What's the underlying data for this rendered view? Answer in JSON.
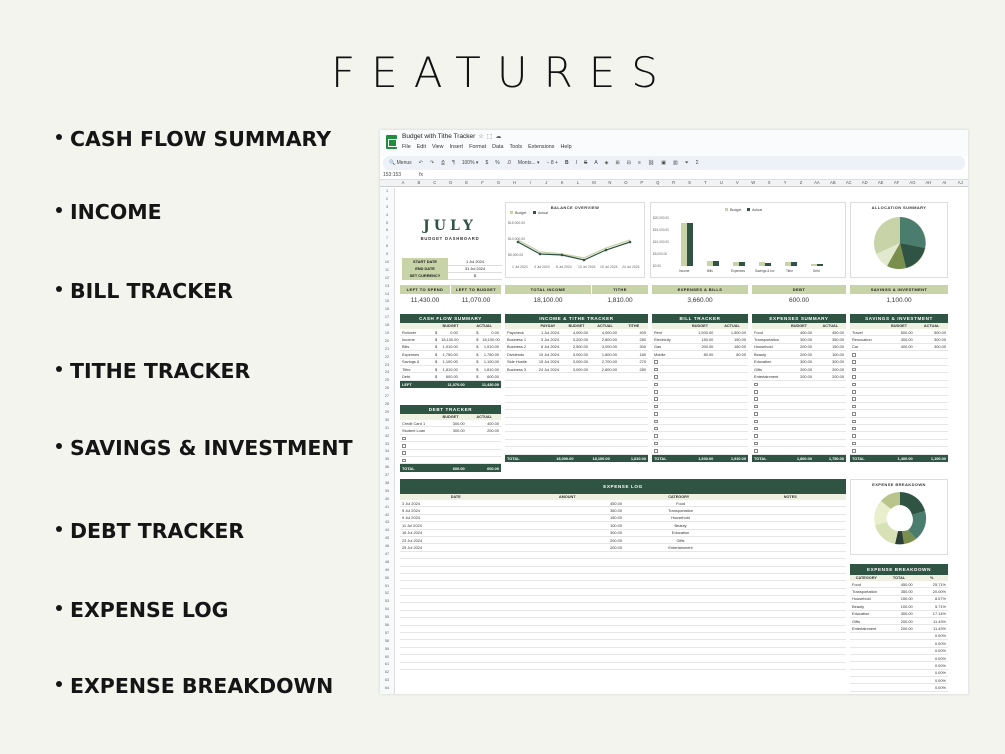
{
  "page_title": "FEATURES",
  "features": [
    "CASH FLOW SUMMARY",
    "INCOME",
    "BILL TRACKER",
    "TITHE TRACKER",
    "SAVINGS & INVESTMENT",
    "DEBT TRACKER",
    "EXPENSE LOG",
    "EXPENSE BREAKDOWN"
  ],
  "sheet": {
    "doc_title": "Budget with Tithe Tracker",
    "menu": [
      "File",
      "Edit",
      "View",
      "Insert",
      "Format",
      "Data",
      "Tools",
      "Extensions",
      "Help"
    ],
    "toolbar": {
      "menus_label": "Menus",
      "zoom": "100%",
      "font": "Monts...",
      "font_size": "8"
    },
    "cell_ref": "153:153",
    "fx": "fx",
    "columns": [
      "A",
      "B",
      "C",
      "D",
      "E",
      "F",
      "G",
      "H",
      "I",
      "J",
      "K",
      "L",
      "M",
      "N",
      "O",
      "P",
      "Q",
      "R",
      "S",
      "T",
      "U",
      "V",
      "W",
      "X",
      "Y",
      "Z",
      "AA",
      "AB",
      "AC",
      "AD",
      "AE",
      "AF",
      "AG",
      "AH",
      "AI",
      "AJ"
    ],
    "month": "JULY",
    "dashboard_label": "BUDGET DASHBOARD",
    "start_date": {
      "label": "START DATE",
      "value": "1 Jul 2024"
    },
    "end_date": {
      "label": "END DATE",
      "value": "31 Jul 2024"
    },
    "currency": {
      "label": "SET CURRENCY",
      "value": "$"
    },
    "balance_overview": {
      "title": "BALANCE OVERVIEW",
      "legend": [
        "Budget",
        "Actual"
      ],
      "y_ticks": [
        "$15,000.00",
        "$10,000.00",
        "$5,000.00",
        "$0.00"
      ],
      "x_ticks": [
        "1 Jul 2024",
        "3 Jul 2024",
        "8 Jul 2024",
        "10 Jul 2024",
        "15 Jul 2024",
        "24 Jul 2024"
      ]
    },
    "bar_overview": {
      "legend": [
        "Budget",
        "Actual"
      ],
      "y_ticks": [
        "$20,000.00",
        "$15,000.00",
        "$10,000.00",
        "$5,000.00",
        "$0.00"
      ],
      "categories": [
        "Income",
        "Bills",
        "Expenses",
        "Savings & Inv",
        "Tithe",
        "Debt"
      ]
    },
    "allocation": {
      "title": "ALLOCATION SUMMARY"
    },
    "stats": [
      {
        "label": "LEFT TO SPEND",
        "value": "11,430.00"
      },
      {
        "label": "LEFT TO BUDGET",
        "value": "11,070.00"
      },
      {
        "label": "TOTAL INCOME",
        "value": "18,100.00"
      },
      {
        "label": "TITHE",
        "value": "1,810.00"
      },
      {
        "label": "EXPENSES & BILLS",
        "value": "3,660.00"
      },
      {
        "label": "DEBT",
        "value": "600.00"
      },
      {
        "label": "SAVINGS & INVESTMENT",
        "value": "1,100.00"
      }
    ],
    "cash_flow": {
      "title": "CASH FLOW SUMMARY",
      "headers": [
        "",
        "BUDGET",
        "ACTUAL"
      ],
      "rows": [
        [
          "Rollover",
          "$",
          "0.00",
          "$",
          "0.00"
        ],
        [
          "Income",
          "$",
          "18,100.00",
          "$",
          "18,100.00"
        ],
        [
          "Bills",
          "$",
          "1,910.00",
          "$",
          "1,910.00"
        ],
        [
          "Expenses",
          "$",
          "1,750.00",
          "$",
          "1,750.00"
        ],
        [
          "Savings & Inv",
          "$",
          "1,100.00",
          "$",
          "1,100.00"
        ],
        [
          "Tithe",
          "$",
          "1,810.00",
          "$",
          "1,810.00"
        ],
        [
          "Debt",
          "$",
          "600.00",
          "$",
          "600.00"
        ]
      ],
      "total": [
        "LEFT",
        "11,070.00",
        "11,430.00"
      ]
    },
    "income": {
      "title": "INCOME & TITHE TRACKER",
      "headers": [
        "",
        "PAYDAY",
        "BUDGET",
        "ACTUAL",
        "TITHE"
      ],
      "rows": [
        [
          "Paycheck",
          "1 Jul 2024",
          "4,000.00",
          "4,000.00",
          "400"
        ],
        [
          "Business 1",
          "3 Jul 2024",
          "3,200.00",
          "2,800.00",
          "280"
        ],
        [
          "Business 2",
          "8 Jul 2024",
          "2,500.00",
          "3,000.00",
          "300"
        ],
        [
          "Dividends",
          "10 Jul 2024",
          "3,000.00",
          "1,800.00",
          "180"
        ],
        [
          "Side Hustle",
          "15 Jul 2024",
          "3,000.00",
          "2,700.00",
          "270"
        ],
        [
          "Business 3",
          "24 Jul 2024",
          "3,000.00",
          "2,800.00",
          "280"
        ]
      ],
      "total": [
        "TOTAL",
        "18,000.00",
        "18,100.00",
        "1,810.00"
      ]
    },
    "bill": {
      "title": "BILL TRACKER",
      "headers": [
        "",
        "BUDGET",
        "ACTUAL"
      ],
      "rows": [
        [
          "Rent",
          "1,500.00",
          "1,500.00"
        ],
        [
          "Electricity",
          "150.00",
          "150.00"
        ],
        [
          "Gas",
          "200.00",
          "180.00"
        ],
        [
          "Mobile",
          "80.00",
          "80.00"
        ]
      ],
      "total": [
        "TOTAL",
        "1,930.00",
        "1,910.00"
      ]
    },
    "expenses": {
      "title": "EXPENSES SUMMARY",
      "headers": [
        "",
        "BUDGET",
        "ACTUAL"
      ],
      "rows": [
        [
          "Food",
          "400.00",
          "450.00"
        ],
        [
          "Transportation",
          "300.00",
          "350.00"
        ],
        [
          "Household",
          "200.00",
          "150.00"
        ],
        [
          "Beauty",
          "200.00",
          "100.00"
        ],
        [
          "Education",
          "300.00",
          "300.00"
        ],
        [
          "Gifts",
          "200.00",
          "200.00"
        ],
        [
          "Entertainment",
          "200.00",
          "200.00"
        ]
      ],
      "total": [
        "TOTAL",
        "1,800.00",
        "1,750.00"
      ]
    },
    "savings": {
      "title": "SAVINGS & INVESTMENT",
      "headers": [
        "",
        "BUDGET",
        "ACTUAL"
      ],
      "rows": [
        [
          "Travel",
          "500.00",
          "500.00"
        ],
        [
          "Renovation",
          "300.00",
          "300.00"
        ],
        [
          "Car",
          "400.00",
          "300.00"
        ]
      ],
      "total": [
        "TOTAL",
        "1,400.00",
        "1,100.00"
      ]
    },
    "debt": {
      "title": "DEBT TRACKER",
      "headers": [
        "",
        "BUDGET",
        "ACTUAL"
      ],
      "rows": [
        [
          "Credit Card 1",
          "300.00",
          "400.00"
        ],
        [
          "Student Loan",
          "300.00",
          "200.00"
        ]
      ],
      "total": [
        "TOTAL",
        "600.00",
        "600.00"
      ]
    },
    "expense_log": {
      "title": "EXPENSE LOG",
      "headers": [
        "DATE",
        "AMOUNT",
        "CATEGORY",
        "NOTES"
      ],
      "rows": [
        [
          "3 Jul 2024",
          "450.00",
          "Food"
        ],
        [
          "5 Jul 2024",
          "350.00",
          "Transportation"
        ],
        [
          "9 Jul 2024",
          "150.00",
          "Household"
        ],
        [
          "11 Jul 2024",
          "100.00",
          "Beauty"
        ],
        [
          "16 Jul 2024",
          "300.00",
          "Education"
        ],
        [
          "23 Jul 2024",
          "200.00",
          "Gifts"
        ],
        [
          "25 Jul 2024",
          "200.00",
          "Entertainment"
        ]
      ]
    },
    "expense_donut": {
      "title": "EXPENSE BREAKDOWN"
    },
    "expense_table": {
      "title": "EXPENSE BREAKDOWN",
      "headers": [
        "CATEGORY",
        "TOTAL",
        "%"
      ],
      "rows": [
        [
          "Food",
          "450.00",
          "25.71%"
        ],
        [
          "Transportation",
          "350.00",
          "20.00%"
        ],
        [
          "Household",
          "150.00",
          "8.57%"
        ],
        [
          "Beauty",
          "100.00",
          "5.71%"
        ],
        [
          "Education",
          "300.00",
          "17.14%"
        ],
        [
          "Gifts",
          "200.00",
          "11.43%"
        ],
        [
          "Entertainment",
          "200.00",
          "11.43%"
        ]
      ],
      "empty_pct": "0.00%"
    },
    "colors": {
      "dark_green": "#2f5444",
      "sage": "#c9d3a8",
      "olive": "#7a8f4e",
      "teal": "#4a7d6e"
    }
  }
}
